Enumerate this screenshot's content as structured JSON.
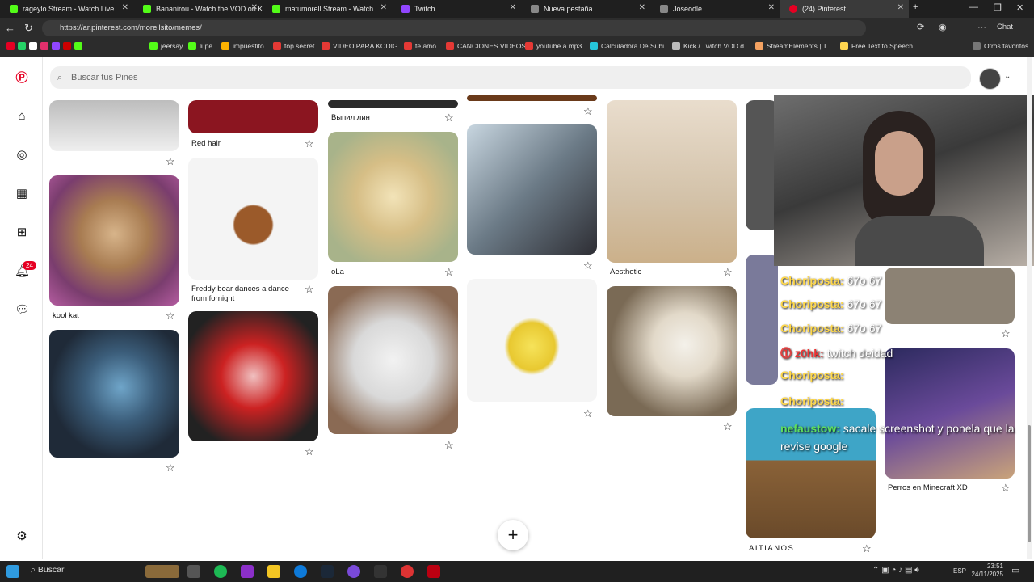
{
  "tabs": [
    {
      "label": "rageylo Stream - Watch Live",
      "color": "#53fc18"
    },
    {
      "label": "Bananirou - Watch the VOD on K",
      "color": "#53fc18"
    },
    {
      "label": "matumorell Stream - Watch",
      "color": "#53fc18"
    },
    {
      "label": "Twitch",
      "color": "#9146ff"
    },
    {
      "label": "Nueva pestaña",
      "color": "#888"
    },
    {
      "label": "Joseodle",
      "color": "#888"
    },
    {
      "label": "(24) Pinterest",
      "color": "#e60023"
    }
  ],
  "url": "https://ar.pinterest.com/morellsito/memes/",
  "chat_label": "Chat",
  "bookmarks": [
    "jeersay",
    "lupe",
    "impuestito",
    "top secret",
    "VIDEO PARA KODIG...",
    "te amo",
    "CANCIONES VIDEOS",
    "youtube a mp3",
    "Calculadora De Subi...",
    "Kick / Twitch VOD d...",
    "StreamElements | T...",
    "Free Text to Speech...",
    "Otros favoritos"
  ],
  "search_placeholder": "Buscar tus Pines",
  "notification_count": "24",
  "pins": {
    "red_hair": "Red hair",
    "vypil": "Выпил лин",
    "aesthetic": "Aesthetic",
    "ola": "oLa",
    "freddy": "Freddy bear dances a dance from fornight",
    "kool": "kool kat",
    "minecraft": "Perros en Minecraft XD",
    "aitianos": "AITIANOS"
  },
  "chat_messages": [
    {
      "user": "Choriposta:",
      "text": "67o 67"
    },
    {
      "user": "Choriposta:",
      "text": "67o 67"
    },
    {
      "user": "Choriposta:",
      "text": "67o 67"
    },
    {
      "user": "z0hk:",
      "text": "twitch deidad"
    },
    {
      "user": "Choriposta:",
      "text": ""
    },
    {
      "user": "Choriposta:",
      "text": ""
    },
    {
      "user": "nefaustow:",
      "text": "sacale screenshot y ponela que la revise google"
    }
  ],
  "taskbar": {
    "search": "Buscar",
    "lang": "ESP",
    "time": "23:51",
    "date": "24/11/2025"
  }
}
